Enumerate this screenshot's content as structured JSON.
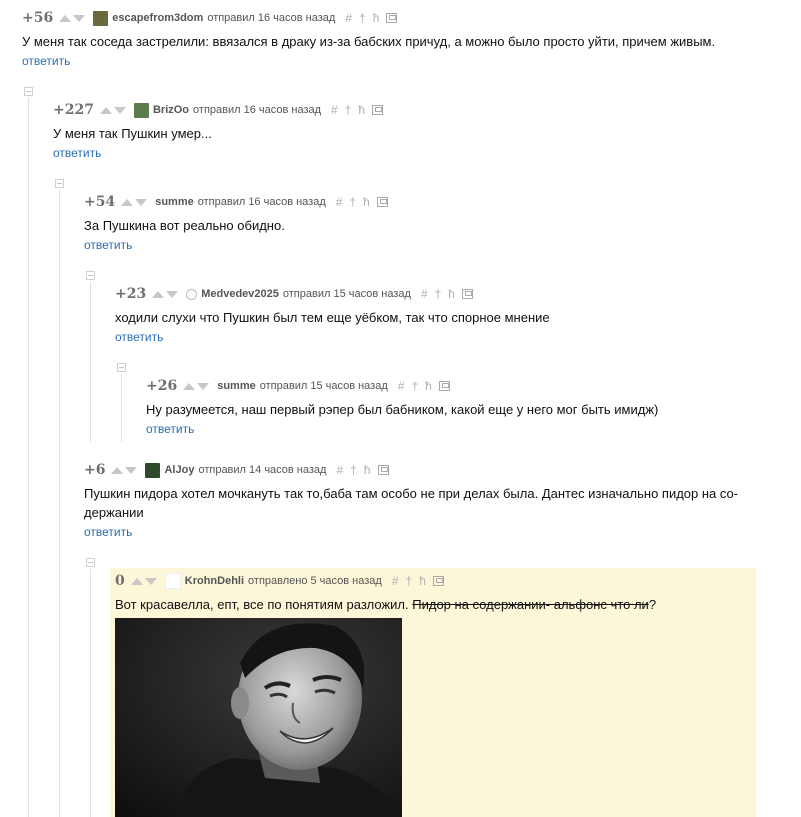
{
  "comments": [
    {
      "score": "+56",
      "author": "escapefrom3dom",
      "sent": "отправил 16 часов назад",
      "text": "У меня так соседа застрелили: ввязался в драку из-за бабских причуд, а можно было просто уйти, причем живым.",
      "reply": "ответить",
      "avatar_color": "#6b6a3e"
    },
    {
      "score": "+227",
      "author": "BrizOo",
      "sent": "отправил 16 часов назад",
      "text": "У меня так Пушкин умер...",
      "reply": "ответить",
      "avatar_color": "#5d7c4e"
    },
    {
      "score": "+54",
      "author": "summe",
      "sent": "отправил 16 часов назад",
      "text": "За Пушкина вот реально обидно.",
      "reply": "ответить"
    },
    {
      "score": "+23",
      "author": "Medvedev2025",
      "sent": "отправил 15 часов назад",
      "text": "ходили слухи что Пушкин был тем еще уёбком, так что спорное мнение",
      "reply": "ответить",
      "avatar_color": "#777777"
    },
    {
      "score": "+26",
      "author": "summe",
      "sent": "отправил 15 часов назад",
      "text": "Ну разумеется, наш первый рэпер был бабником, какой еще у него мог быть имидж)",
      "reply": "ответить"
    },
    {
      "score": "+6",
      "author": "AlJoy",
      "sent": "отправил 14 часов назад",
      "text_line1": "Пушкин пидора хотел мочкануть так то,баба там особо не при делах была. Дантес изначально пидор на со-",
      "text_line2": "держании",
      "reply": "ответить",
      "avatar_color": "#2f4a2a"
    },
    {
      "score": "0",
      "author": "KrohnDehli",
      "sent": "отправлено 5 часов назад",
      "text": "Вот красавелла, епт, все по понятиям разложил. ",
      "text_strike": "Пидор на содержании- альфонс что ли",
      "text_end": "?",
      "avatar_color": "#ffffff"
    }
  ],
  "tools": {
    "hash": "#",
    "pin": "†",
    "link": "ħ"
  },
  "colors": {
    "reply_link": "#2a6db0",
    "highlight_bg": "#fdf7d9"
  }
}
